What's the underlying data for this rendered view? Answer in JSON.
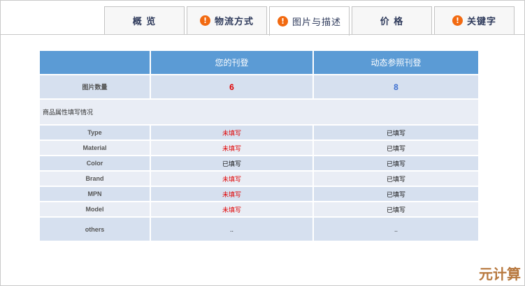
{
  "tabs": [
    {
      "label": "概 览",
      "warn": false
    },
    {
      "label": "物流方式",
      "warn": true
    },
    {
      "label": "图片与描述",
      "warn": true,
      "active": true
    },
    {
      "label": "价 格",
      "warn": false
    },
    {
      "label": "关键字",
      "warn": true
    }
  ],
  "table": {
    "headers": [
      "",
      "您的刊登",
      "动态参照刊登"
    ],
    "image_count": {
      "label": "图片数量",
      "yours": "6",
      "reference": "8"
    },
    "section_label": "商品属性填写情况",
    "rows": [
      {
        "label": "Type",
        "yours": "未填写",
        "reference": "已填写"
      },
      {
        "label": "Material",
        "yours": "未填写",
        "reference": "已填写"
      },
      {
        "label": "Color",
        "yours": "已填写",
        "reference": "已填写"
      },
      {
        "label": "Brand",
        "yours": "未填写",
        "reference": "已填写"
      },
      {
        "label": "MPN",
        "yours": "未填写",
        "reference": "已填写"
      },
      {
        "label": "Model",
        "yours": "未填写",
        "reference": "已填写"
      }
    ],
    "others": {
      "label": "others",
      "yours": "..",
      "reference": ".."
    }
  },
  "watermark": "元计算",
  "colors": {
    "header": "#5b9bd5",
    "row_dark": "#d6e0ef",
    "row_light": "#e9edf5",
    "warn": "#f26a11",
    "unfilled": "#e00000"
  }
}
